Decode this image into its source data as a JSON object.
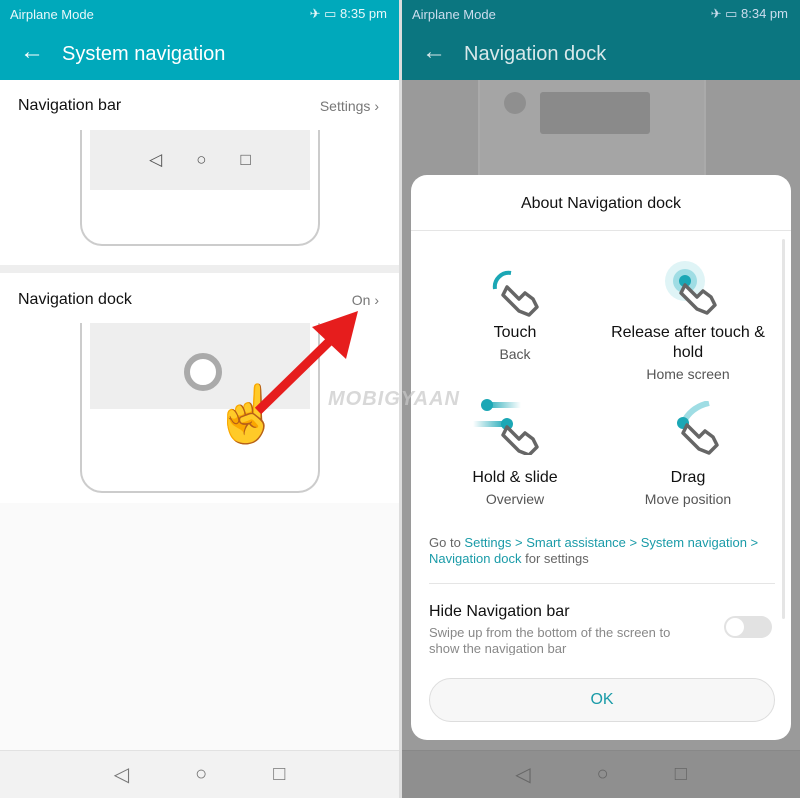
{
  "colors": {
    "accent": "#00a9bb",
    "link": "#1a9ba8"
  },
  "left": {
    "status": {
      "mode": "Airplane Mode",
      "time": "8:35 pm"
    },
    "header": {
      "title": "System navigation",
      "back_icon": "arrow-left-icon"
    },
    "nav_bar": {
      "title": "Navigation bar",
      "value": "Settings"
    },
    "nav_dock": {
      "title": "Navigation dock",
      "value": "On"
    }
  },
  "right": {
    "status": {
      "mode": "Airplane Mode",
      "time": "8:34 pm"
    },
    "header": {
      "title": "Navigation dock"
    },
    "dialog": {
      "title": "About Navigation dock",
      "gestures": [
        {
          "name": "Touch",
          "action": "Back"
        },
        {
          "name": "Release after touch & hold",
          "action": "Home screen"
        },
        {
          "name": "Hold & slide",
          "action": "Overview"
        },
        {
          "name": "Drag",
          "action": "Move position"
        }
      ],
      "hint": {
        "prefix": "Go to ",
        "path": "Settings > Smart assistance > System navigation > Navigation dock",
        "suffix": " for settings"
      },
      "hide_nav": {
        "title": "Hide Navigation bar",
        "desc": "Swipe up from the bottom of the screen to show the navigation bar",
        "enabled": false
      },
      "ok": "OK"
    }
  },
  "watermark": "MOBIGYAAN"
}
